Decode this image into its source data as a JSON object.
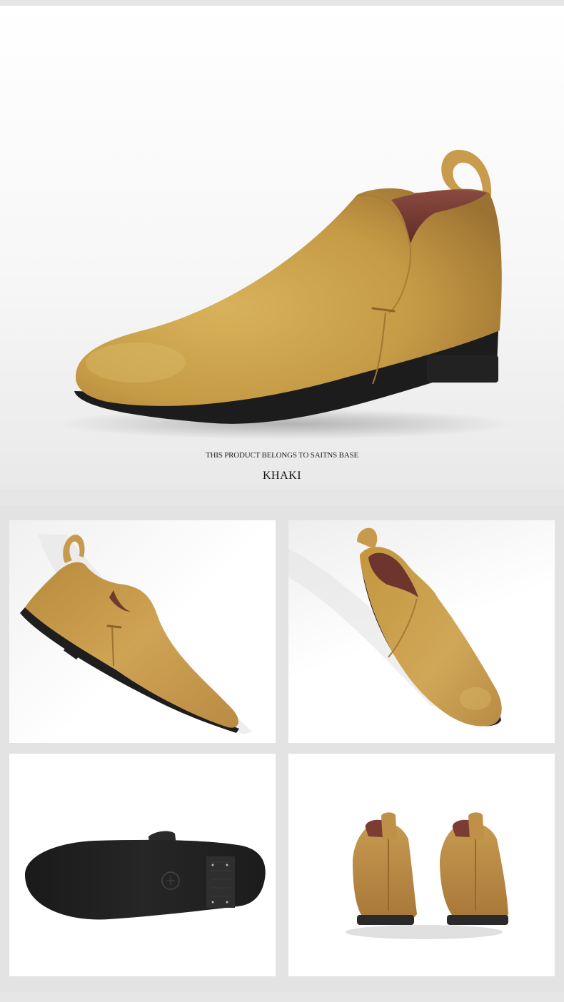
{
  "hero": {
    "tagline": "THIS PRODUCT BELONGS TO SAITNS BASE",
    "color_name": "KHAKI"
  },
  "gallery": {
    "views": [
      {
        "name": "side-profile"
      },
      {
        "name": "top-angle"
      },
      {
        "name": "outsole"
      },
      {
        "name": "rear-pair"
      }
    ]
  },
  "colors": {
    "leather": "#c8a04a",
    "leather_dark": "#a77a2e",
    "lining": "#7a3a34",
    "sole": "#1e1e1e",
    "page_bg": "#e6e6e6"
  }
}
